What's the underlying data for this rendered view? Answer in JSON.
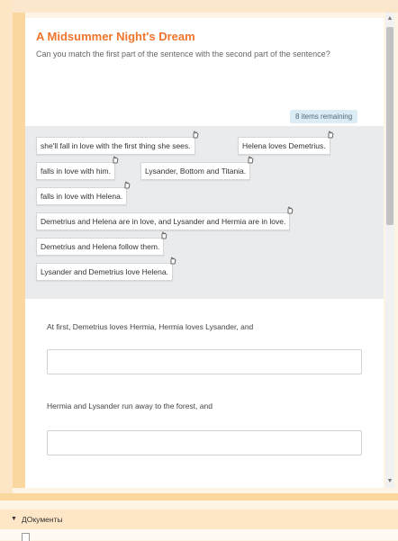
{
  "quiz": {
    "title": "A Midsummer Night's Dream",
    "instructions": "Can you match the first part of the sentence with the second part of the sentence?",
    "remaining": "8 items remaining"
  },
  "drag_items": [
    "she'll fall in love with the first thing she sees.",
    "Helena loves Demetrius.",
    "falls in love with him.",
    "Lysander, Bottom and Titania.",
    "falls in love with Helena.",
    "Demetrius and Helena are in love, and Lysander and Hermia are in love.",
    "Demetrius and Helena follow them.",
    "Lysander and Demetrius love Helena."
  ],
  "questions": [
    {
      "text": "At first, Demetrius loves Hermia, Hermia loves Lysander, and"
    },
    {
      "text": "Hermia and Lysander run away to the forest, and"
    }
  ],
  "section": {
    "label": "ДОкументы",
    "collapse_icon": "triangle-down-icon",
    "file_icon": "document-icon"
  },
  "colors": {
    "title": "#f0742b",
    "frame": "#fbd7a0",
    "badge_bg": "#dcecf5"
  }
}
